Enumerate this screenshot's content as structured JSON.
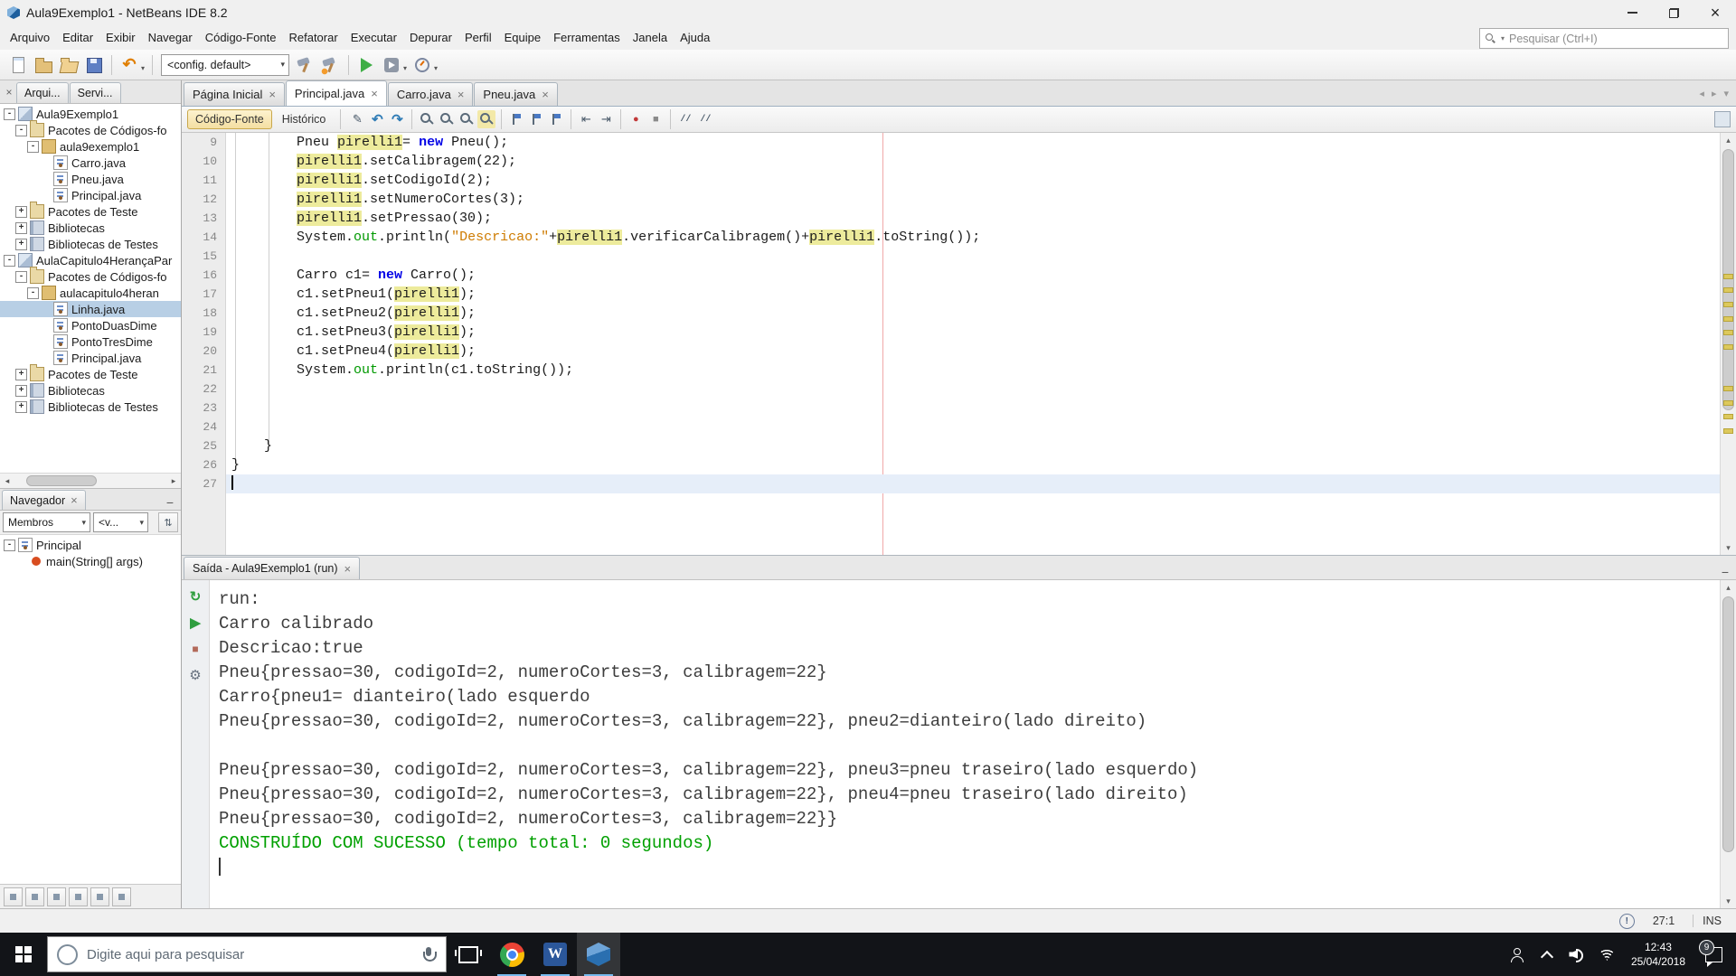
{
  "colors": {
    "success_green": "#00A000",
    "keyword_blue": "#0000E6",
    "string_orange": "#CE7B00",
    "field_green": "#009900",
    "occurrence_yellow": "#EDEB9C",
    "margin_line_red": "#F0A8A8",
    "selection_blue": "#B8CFE5",
    "current_line_blue": "#E6EEF9"
  },
  "titlebar": {
    "title": "Aula9Exemplo1 - NetBeans IDE 8.2"
  },
  "menubar": {
    "items": [
      "Arquivo",
      "Editar",
      "Exibir",
      "Navegar",
      "Código-Fonte",
      "Refatorar",
      "Executar",
      "Depurar",
      "Perfil",
      "Equipe",
      "Ferramentas",
      "Janela",
      "Ajuda"
    ],
    "search_placeholder": "Pesquisar (Ctrl+I)"
  },
  "main_toolbar": {
    "config_value": "<config. default>",
    "icons_left": [
      "new-file-icon",
      "new-project-icon",
      "open-project-icon",
      "save-all-icon",
      "|",
      "undo-icon+dd",
      "|"
    ],
    "icons_right": [
      "build-project-icon",
      "clean-build-icon",
      "|",
      "run-project-icon",
      "debug-project-icon+dd",
      "profile-project-icon+dd"
    ]
  },
  "projects_panel": {
    "tabs": [
      "Arqui...",
      "Servi..."
    ],
    "tree": [
      {
        "label": "Aula9Exemplo1",
        "depth": 0,
        "icon": "project",
        "expander": "minus"
      },
      {
        "label": "Pacotes de Códigos-fo",
        "depth": 1,
        "icon": "folder-src",
        "expander": "minus"
      },
      {
        "label": "aula9exemplo1",
        "depth": 2,
        "icon": "package",
        "expander": "minus"
      },
      {
        "label": "Carro.java",
        "depth": 3,
        "icon": "java"
      },
      {
        "label": "Pneu.java",
        "depth": 3,
        "icon": "java"
      },
      {
        "label": "Principal.java",
        "depth": 3,
        "icon": "java"
      },
      {
        "label": "Pacotes de Teste",
        "depth": 1,
        "icon": "folder-test",
        "expander": "plus"
      },
      {
        "label": "Bibliotecas",
        "depth": 1,
        "icon": "libs",
        "expander": "plus"
      },
      {
        "label": "Bibliotecas de Testes",
        "depth": 1,
        "icon": "libs",
        "expander": "plus"
      },
      {
        "label": "AulaCapitulo4HerançaPar",
        "depth": 0,
        "icon": "project",
        "expander": "minus"
      },
      {
        "label": "Pacotes de Códigos-fo",
        "depth": 1,
        "icon": "folder-src",
        "expander": "minus"
      },
      {
        "label": "aulacapitulo4heran",
        "depth": 2,
        "icon": "package",
        "expander": "minus"
      },
      {
        "label": "Linha.java",
        "depth": 3,
        "icon": "java",
        "selected": true
      },
      {
        "label": "PontoDuasDime",
        "depth": 3,
        "icon": "java"
      },
      {
        "label": "PontoTresDime",
        "depth": 3,
        "icon": "java"
      },
      {
        "label": "Principal.java",
        "depth": 3,
        "icon": "java"
      },
      {
        "label": "Pacotes de Teste",
        "depth": 1,
        "icon": "folder-test",
        "expander": "plus"
      },
      {
        "label": "Bibliotecas",
        "depth": 1,
        "icon": "libs",
        "expander": "plus"
      },
      {
        "label": "Bibliotecas de Testes",
        "depth": 1,
        "icon": "libs",
        "expander": "plus"
      }
    ]
  },
  "navigator": {
    "title": "Navegador",
    "members_combo": "Membros",
    "scope_combo": "<v...",
    "items": [
      {
        "label": "Principal",
        "depth": 0,
        "icon": "class",
        "expander": "minus"
      },
      {
        "label": "main(String[] args)",
        "depth": 1,
        "icon": "method"
      }
    ],
    "footer_icons": [
      "show-inherited-members-icon",
      "show-fields-icon",
      "show-static-members-icon",
      "show-non-public-members-icon",
      "sort-alphabetically-icon",
      "sort-by-source-icon"
    ]
  },
  "editor": {
    "tabs": [
      {
        "label": "Página Inicial"
      },
      {
        "label": "Principal.java",
        "active": true
      },
      {
        "label": "Carro.java"
      },
      {
        "label": "Pneu.java"
      }
    ],
    "source_button": "Código-Fonte",
    "history_button": "Histórico",
    "toolbar_icons": [
      "last-edit-icon",
      "back-icon",
      "forward-icon",
      "|",
      "find-selection-icon",
      "find-next-icon",
      "find-prev-icon",
      "toggle-highlight-icon",
      "|",
      "previous-bookmark-icon",
      "next-bookmark-icon",
      "toggle-bookmark-icon",
      "|",
      "shift-left-icon",
      "shift-right-icon",
      "|",
      "record-macro-icon",
      "stop-macro-icon",
      "|",
      "comment-icon",
      "uncomment-icon"
    ],
    "code": [
      {
        "n": 9,
        "tokens": [
          {
            "t": "        Pneu "
          },
          {
            "t": "pirelli1",
            "c": "hl"
          },
          {
            "t": "= "
          },
          {
            "t": "new",
            "c": "kw"
          },
          {
            "t": " Pneu();"
          }
        ]
      },
      {
        "n": 10,
        "tokens": [
          {
            "t": "        "
          },
          {
            "t": "pirelli1",
            "c": "hl"
          },
          {
            "t": ".setCalibragem(22);"
          }
        ]
      },
      {
        "n": 11,
        "tokens": [
          {
            "t": "        "
          },
          {
            "t": "pirelli1",
            "c": "hl"
          },
          {
            "t": ".setCodigoId(2);"
          }
        ]
      },
      {
        "n": 12,
        "tokens": [
          {
            "t": "        "
          },
          {
            "t": "pirelli1",
            "c": "hl"
          },
          {
            "t": ".setNumeroCortes(3);"
          }
        ]
      },
      {
        "n": 13,
        "tokens": [
          {
            "t": "        "
          },
          {
            "t": "pirelli1",
            "c": "hl"
          },
          {
            "t": ".setPressao(30);"
          }
        ]
      },
      {
        "n": 14,
        "tokens": [
          {
            "t": "        System."
          },
          {
            "t": "out",
            "c": "fld"
          },
          {
            "t": ".println("
          },
          {
            "t": "\"Descricao:\"",
            "c": "str"
          },
          {
            "t": "+"
          },
          {
            "t": "pirelli1",
            "c": "hl"
          },
          {
            "t": ".verificarCalibragem()+"
          },
          {
            "t": "pirelli1",
            "c": "hl"
          },
          {
            "t": ".toString());"
          }
        ]
      },
      {
        "n": 15,
        "tokens": []
      },
      {
        "n": 16,
        "tokens": [
          {
            "t": "        Carro c1= "
          },
          {
            "t": "new",
            "c": "kw"
          },
          {
            "t": " Carro();"
          }
        ]
      },
      {
        "n": 17,
        "tokens": [
          {
            "t": "        c1.setPneu1("
          },
          {
            "t": "pirelli1",
            "c": "hl"
          },
          {
            "t": ");"
          }
        ]
      },
      {
        "n": 18,
        "tokens": [
          {
            "t": "        c1.setPneu2("
          },
          {
            "t": "pirelli1",
            "c": "hl"
          },
          {
            "t": ");"
          }
        ]
      },
      {
        "n": 19,
        "tokens": [
          {
            "t": "        c1.setPneu3("
          },
          {
            "t": "pirelli1",
            "c": "hl"
          },
          {
            "t": ");"
          }
        ]
      },
      {
        "n": 20,
        "tokens": [
          {
            "t": "        c1.setPneu4("
          },
          {
            "t": "pirelli1",
            "c": "hl"
          },
          {
            "t": ");"
          }
        ]
      },
      {
        "n": 21,
        "tokens": [
          {
            "t": "        System."
          },
          {
            "t": "out",
            "c": "fld"
          },
          {
            "t": ".println(c1.toString());"
          }
        ]
      },
      {
        "n": 22,
        "tokens": []
      },
      {
        "n": 23,
        "tokens": []
      },
      {
        "n": 24,
        "tokens": []
      },
      {
        "n": 25,
        "tokens": [
          {
            "t": "    }"
          }
        ]
      },
      {
        "n": 26,
        "tokens": [
          {
            "t": "}"
          }
        ]
      },
      {
        "n": 27,
        "tokens": [],
        "current": true
      }
    ]
  },
  "output": {
    "tab_label": "Saída - Aula9Exemplo1 (run)",
    "buttons": [
      "rerun-icon",
      "rerun-modified-icon",
      "stop-build-icon",
      "ant-settings-icon"
    ],
    "lines": [
      {
        "text": "run:"
      },
      {
        "text": "Carro calibrado"
      },
      {
        "text": "Descricao:true"
      },
      {
        "text": "Pneu{pressao=30, codigoId=2, numeroCortes=3, calibragem=22}"
      },
      {
        "text": "Carro{pneu1= dianteiro(lado esquerdo"
      },
      {
        "text": "Pneu{pressao=30, codigoId=2, numeroCortes=3, calibragem=22}, pneu2=dianteiro(lado direito)"
      },
      {
        "text": ""
      },
      {
        "text": "Pneu{pressao=30, codigoId=2, numeroCortes=3, calibragem=22}, pneu3=pneu traseiro(lado esquerdo)"
      },
      {
        "text": "Pneu{pressao=30, codigoId=2, numeroCortes=3, calibragem=22}, pneu4=pneu traseiro(lado direito)"
      },
      {
        "text": "Pneu{pressao=30, codigoId=2, numeroCortes=3, calibragem=22}}"
      },
      {
        "text": "CONSTRUÍDO COM SUCESSO (tempo total: 0 segundos)",
        "type": "success"
      },
      {
        "text": "",
        "caret": true
      }
    ]
  },
  "statusbar": {
    "caret_position": "27:1",
    "insert_mode": "INS"
  },
  "taskbar": {
    "search_placeholder": "Digite aqui para pesquisar",
    "clock_time": "12:43",
    "clock_date": "25/04/2018",
    "notification_count": "9"
  }
}
